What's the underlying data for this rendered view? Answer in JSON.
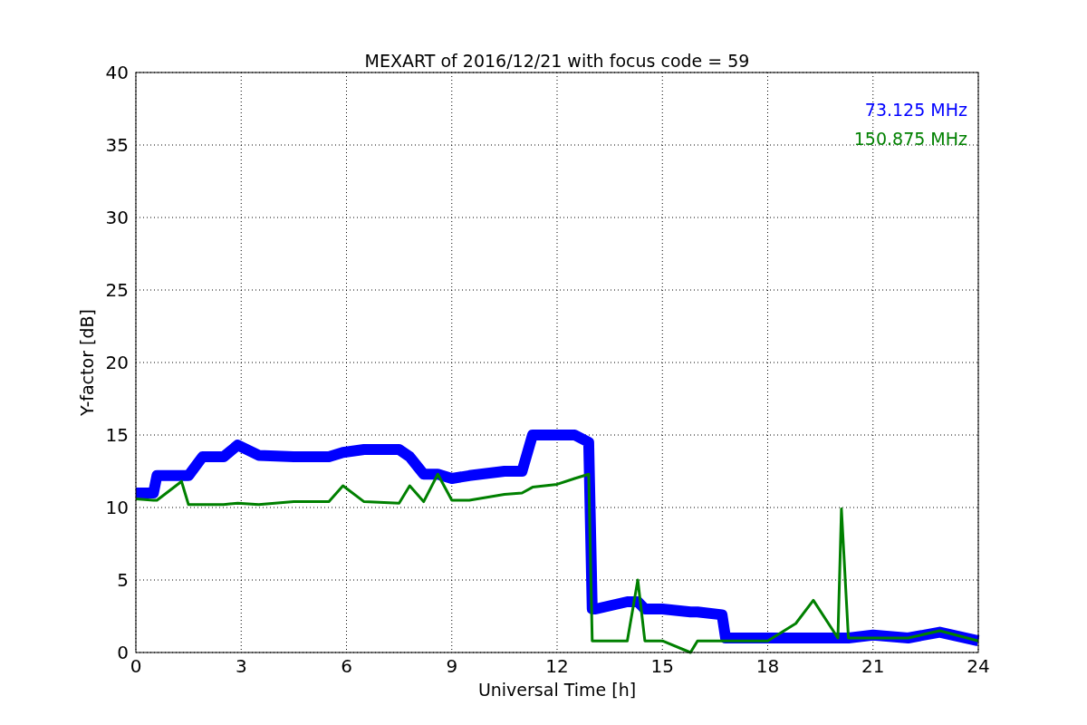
{
  "chart_data": {
    "type": "line",
    "title": "MEXART of 2016/12/21 with focus code = 59",
    "xlabel": "Universal Time [h]",
    "ylabel": "Y-factor [dB]",
    "x": [
      0,
      0.5,
      0.6,
      1.3,
      1.5,
      1.9,
      2.5,
      2.9,
      3.5,
      4.5,
      5.5,
      5.9,
      6.5,
      7.5,
      7.8,
      8.2,
      8.6,
      9,
      9.5,
      10.5,
      11,
      11.3,
      12,
      12.5,
      12.9,
      13,
      13.1,
      14,
      14.3,
      14.5,
      15,
      15.8,
      16,
      16.7,
      16.8,
      18,
      18.8,
      19.3,
      20,
      20.1,
      20.3,
      21,
      22,
      22.9,
      24
    ],
    "series": [
      {
        "name": "73.125 MHz",
        "color": "#0000ff",
        "values": [
          11,
          11,
          12.2,
          12.2,
          12.2,
          13.5,
          13.5,
          14.3,
          13.6,
          13.5,
          13.5,
          13.8,
          14,
          14,
          13.5,
          12.3,
          12.3,
          12,
          12.2,
          12.5,
          12.5,
          15,
          15,
          15,
          14.5,
          3,
          3,
          3.5,
          3.5,
          3,
          3,
          2.8,
          2.8,
          2.6,
          1,
          1,
          1,
          1,
          1,
          1,
          1,
          1.2,
          1,
          1.4,
          0.8
        ]
      },
      {
        "name": "150.875 MHz",
        "color": "#008000",
        "values": [
          10.6,
          10.5,
          10.5,
          11.8,
          10.2,
          10.2,
          10.2,
          10.3,
          10.2,
          10.4,
          10.4,
          11.5,
          10.4,
          10.3,
          11.5,
          10.4,
          12.3,
          10.5,
          10.5,
          10.9,
          11,
          11.4,
          11.6,
          12,
          12.3,
          0.8,
          0.8,
          0.8,
          5,
          0.8,
          0.8,
          0,
          0.8,
          0.8,
          0.8,
          0.8,
          2,
          3.6,
          1,
          9.9,
          1,
          1,
          1,
          1.5,
          0.8
        ]
      }
    ],
    "xlim": [
      0,
      24
    ],
    "ylim": [
      0,
      40
    ],
    "xticks": [
      0,
      3,
      6,
      9,
      12,
      15,
      18,
      21,
      24
    ],
    "yticks": [
      0,
      5,
      10,
      15,
      20,
      25,
      30,
      35,
      40
    ],
    "grid": true
  }
}
